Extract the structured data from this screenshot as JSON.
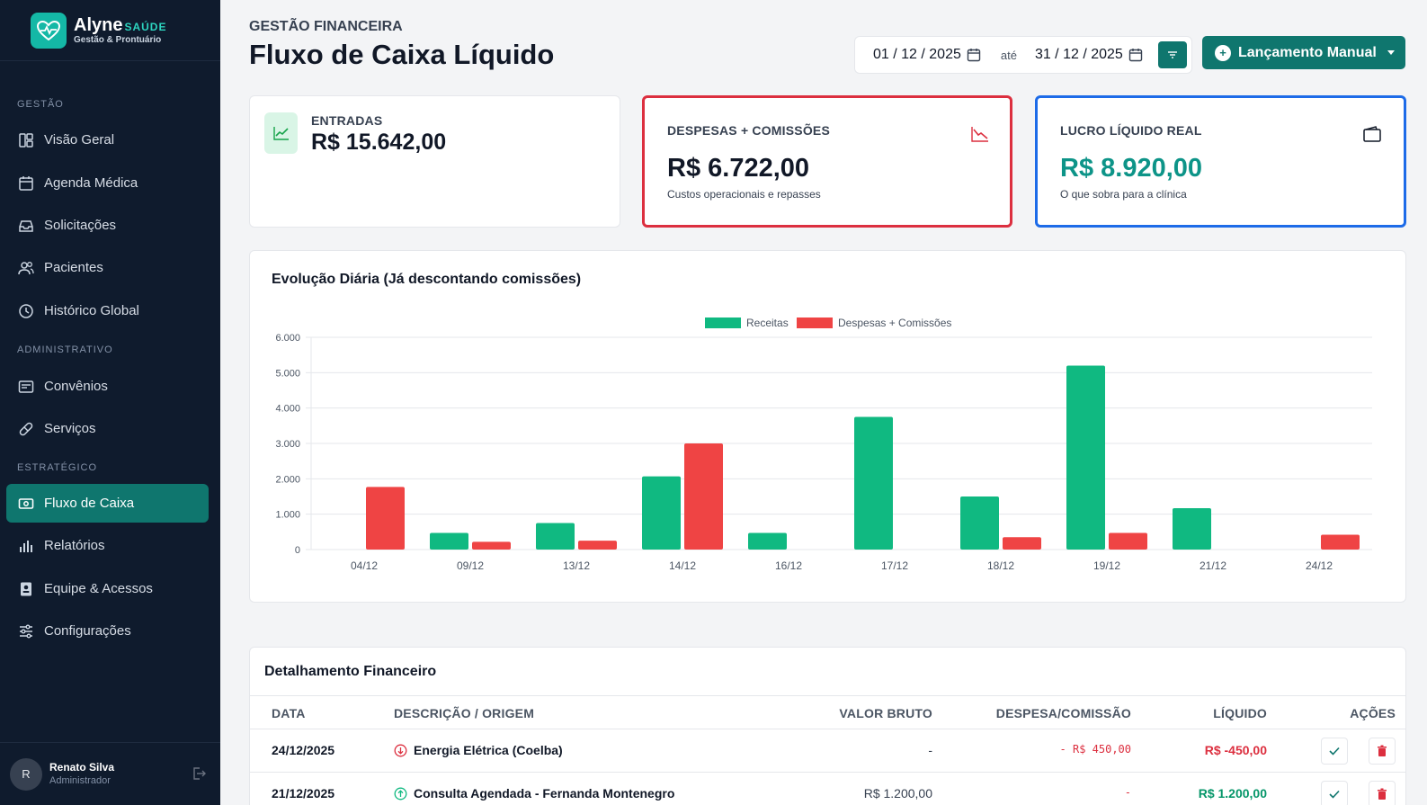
{
  "brand": {
    "name": "Alyne",
    "tag": "SAÚDE",
    "sub": "Gestão & Prontuário"
  },
  "sidebar": {
    "sections": [
      {
        "label": "GESTÃO"
      },
      {
        "label": "ADMINISTRATIVO"
      },
      {
        "label": "ESTRATÉGICO"
      }
    ],
    "items": [
      {
        "label": "Visão Geral",
        "icon": "dashboard-icon"
      },
      {
        "label": "Agenda Médica",
        "icon": "calendar-icon"
      },
      {
        "label": "Solicitações",
        "icon": "inbox-icon"
      },
      {
        "label": "Pacientes",
        "icon": "users-icon"
      },
      {
        "label": "Histórico Global",
        "icon": "clock-icon"
      },
      {
        "label": "Convênios",
        "icon": "card-icon"
      },
      {
        "label": "Serviços",
        "icon": "pill-icon"
      },
      {
        "label": "Fluxo de Caixa",
        "icon": "cash-icon",
        "active": true
      },
      {
        "label": "Relatórios",
        "icon": "bar-chart-icon"
      },
      {
        "label": "Equipe & Acessos",
        "icon": "badge-icon"
      },
      {
        "label": "Configurações",
        "icon": "sliders-icon"
      }
    ]
  },
  "user": {
    "initial": "R",
    "name": "Renato Silva",
    "role": "Administrador"
  },
  "header": {
    "eyebrow": "GESTÃO FINANCEIRA",
    "title": "Fluxo de Caixa Líquido",
    "date_from": "01 / 12 / 2025",
    "date_sep": "até",
    "date_to": "31 / 12 / 2025",
    "manual_button": "Lançamento Manual"
  },
  "kpis": {
    "entradas": {
      "label": "ENTRADAS",
      "value": "R$ 15.642,00"
    },
    "despesas": {
      "label": "DESPESAS + COMISSÕES",
      "value": "R$ 6.722,00",
      "sub": "Custos operacionais e repasses"
    },
    "lucro": {
      "label": "LUCRO LÍQUIDO REAL",
      "value": "R$ 8.920,00",
      "sub": "O que sobra para a clínica"
    }
  },
  "colors": {
    "primary": "#0f766e",
    "income": "#10b981",
    "expense": "#ef4444",
    "profit": "#0d9488",
    "alert_border": "#dc2f3f",
    "info_border": "#1d6be8"
  },
  "chart_data": {
    "type": "bar",
    "title": "Evolução Diária (Já descontando comissões)",
    "categories": [
      "04/12",
      "09/12",
      "13/12",
      "14/12",
      "16/12",
      "17/12",
      "18/12",
      "19/12",
      "21/12",
      "24/12"
    ],
    "series": [
      {
        "name": "Receitas",
        "color": "#10b981",
        "values": [
          0,
          470,
          750,
          2070,
          470,
          3750,
          1500,
          5200,
          1170,
          0
        ]
      },
      {
        "name": "Despesas + Comissões",
        "color": "#ef4444",
        "values": [
          1770,
          220,
          250,
          3000,
          0,
          0,
          350,
          470,
          0,
          420
        ]
      }
    ],
    "ylim": [
      0,
      6000
    ],
    "yticks": [
      "0",
      "1.000",
      "2.000",
      "3.000",
      "4.000",
      "5.000",
      "6.000"
    ],
    "legend": "top-center",
    "grid": true
  },
  "table": {
    "title": "Detalhamento Financeiro",
    "headers": {
      "date": "DATA",
      "desc": "DESCRIÇÃO / ORIGEM",
      "bruto": "VALOR BRUTO",
      "desp": "DESPESA/COMISSÃO",
      "liq": "LÍQUIDO",
      "acoes": "AÇÕES"
    },
    "rows": [
      {
        "date": "24/12/2025",
        "desc": "Energia Elétrica (Coelba)",
        "type": "out",
        "bruto": "-",
        "desp": "- R$ 450,00",
        "liq": "R$ -450,00"
      },
      {
        "date": "21/12/2025",
        "desc": "Consulta Agendada - Fernanda Montenegro",
        "type": "in",
        "bruto": "R$ 1.200,00",
        "desp": "-",
        "liq": "R$ 1.200,00"
      }
    ]
  }
}
